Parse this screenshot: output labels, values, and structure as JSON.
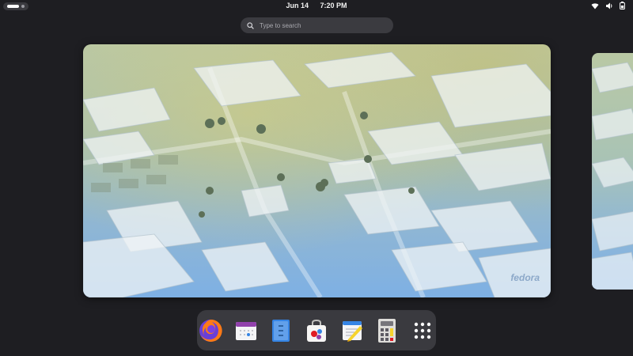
{
  "topbar": {
    "date": "Jun 14",
    "time": "7:20 PM",
    "status_icons": [
      "wifi-icon",
      "volume-icon",
      "battery-icon"
    ]
  },
  "search": {
    "placeholder": "Type to search"
  },
  "workspace": {
    "watermark": "fedora"
  },
  "dock": {
    "apps": [
      "firefox",
      "calendar",
      "text-editor",
      "software",
      "notes",
      "calculator",
      "show-apps"
    ]
  },
  "colors": {
    "background": "#1e1e22",
    "panel": "#3a3a3f",
    "search_bg": "#3b3b40"
  }
}
